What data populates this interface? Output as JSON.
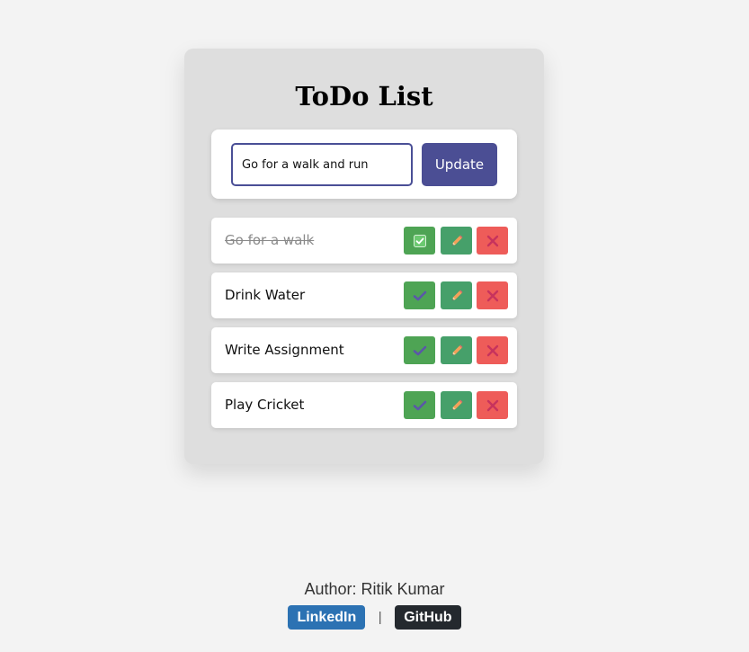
{
  "title": "ToDo List",
  "form": {
    "input_value": "Go for a walk and run",
    "button_label": "Update"
  },
  "tasks": [
    {
      "text": "Go for a walk",
      "completed": true
    },
    {
      "text": "Drink Water",
      "completed": false
    },
    {
      "text": "Write Assignment",
      "completed": false
    },
    {
      "text": "Play Cricket",
      "completed": false
    }
  ],
  "icons": {
    "complete": "check-icon",
    "completed_state": "checkbox-checked-icon",
    "edit": "pencil-icon",
    "delete": "close-icon"
  },
  "colors": {
    "accent": "#4b4e94",
    "complete_button": "#4ea454",
    "edit_button": "#46a06a",
    "delete_button": "#ee5c59",
    "linkedin": "#2c72b3",
    "github": "#24292e"
  },
  "footer": {
    "author": "Author: Ritik Kumar",
    "linkedin_label": "LinkedIn",
    "separator": "|",
    "github_label": "GitHub"
  }
}
